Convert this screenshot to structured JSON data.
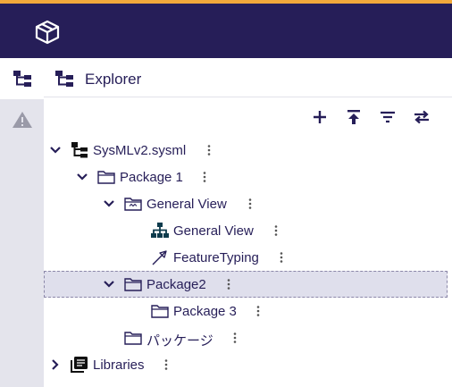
{
  "colors": {
    "accent": "#f2a93b",
    "navbar": "#261e58",
    "sidebar": "#e4e4ec",
    "selected_row": "#dfdfec",
    "text": "#261e58"
  },
  "navbar": {
    "logo_icon": "cube-icon"
  },
  "sidebar": {
    "tabs": [
      {
        "icon": "explorer-tree-icon",
        "active": true
      },
      {
        "icon": "warning-icon",
        "active": false
      }
    ]
  },
  "explorer": {
    "title": "Explorer",
    "toolbar": [
      "add-icon",
      "upload-icon",
      "filter-icon",
      "swap-icon"
    ]
  },
  "tree": [
    {
      "label": "SysMLv2.sysml",
      "icon": "model-tree-icon",
      "expanded": true
    },
    {
      "label": "Package 1",
      "icon": "folder-icon",
      "expanded": true
    },
    {
      "label": "General View",
      "icon": "view-folder-icon",
      "expanded": true
    },
    {
      "label": "General View",
      "icon": "diagram-icon"
    },
    {
      "label": "FeatureTyping",
      "icon": "arrow-icon"
    },
    {
      "label": "Package2",
      "icon": "folder-icon",
      "expanded": true,
      "selected": true
    },
    {
      "label": "Package 3",
      "icon": "folder-icon"
    },
    {
      "label": "パッケージ",
      "icon": "folder-icon"
    },
    {
      "label": "Libraries",
      "icon": "library-icon",
      "expanded": false
    }
  ]
}
